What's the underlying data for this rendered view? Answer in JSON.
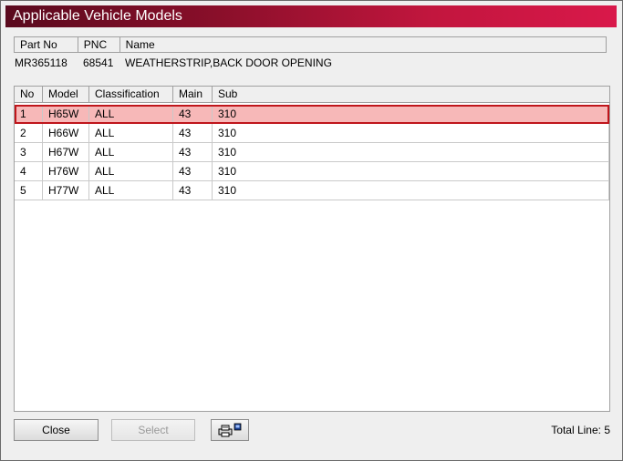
{
  "window": {
    "title": "Applicable Vehicle Models"
  },
  "part_info": {
    "headers": {
      "part_no": "Part No",
      "pnc": "PNC",
      "name": "Name"
    },
    "part_no": "MR365118",
    "pnc": "68541",
    "name": "WEATHERSTRIP,BACK DOOR OPENING"
  },
  "models_table": {
    "headers": {
      "no": "No",
      "model": "Model",
      "classification": "Classification",
      "main": "Main",
      "sub": "Sub"
    },
    "rows": [
      {
        "no": "1",
        "model": "H65W",
        "classification": "ALL",
        "main": "43",
        "sub": "310",
        "selected": true
      },
      {
        "no": "2",
        "model": "H66W",
        "classification": "ALL",
        "main": "43",
        "sub": "310",
        "selected": false
      },
      {
        "no": "3",
        "model": "H67W",
        "classification": "ALL",
        "main": "43",
        "sub": "310",
        "selected": false
      },
      {
        "no": "4",
        "model": "H76W",
        "classification": "ALL",
        "main": "43",
        "sub": "310",
        "selected": false
      },
      {
        "no": "5",
        "model": "H77W",
        "classification": "ALL",
        "main": "43",
        "sub": "310",
        "selected": false
      }
    ]
  },
  "footer": {
    "close_label": "Close",
    "select_label": "Select",
    "print_icon": "printer-icon",
    "total_line": "Total Line: 5"
  },
  "colors": {
    "title_gradient_start": "#5a0a1e",
    "title_gradient_end": "#d9184a",
    "selected_row_bg": "#f7b8b8",
    "selected_row_border": "#c0151b"
  }
}
